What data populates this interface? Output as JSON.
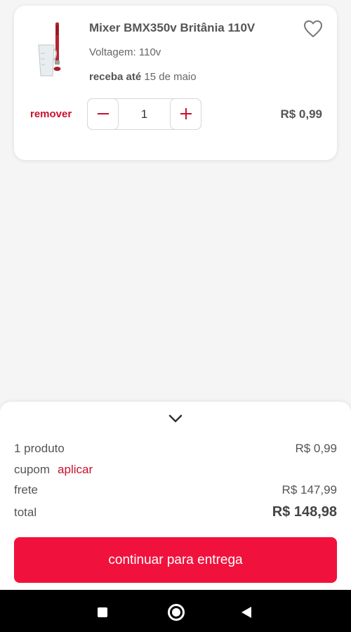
{
  "product": {
    "name": "Mixer BMX350v Britânia 110V",
    "variant": "Voltagem: 110v",
    "delivery_lead": "receba até",
    "delivery_date": "15 de maio",
    "remove_label": "remover",
    "quantity": "1",
    "price": "R$ 0,99",
    "image_icon": "hand-mixer-icon"
  },
  "summary": {
    "products_label": "1 produto",
    "products_value": "R$ 0,99",
    "coupon_label": "cupom",
    "coupon_action": "aplicar",
    "shipping_label": "frete",
    "shipping_value": "R$ 147,99",
    "total_label": "total",
    "total_value": "R$ 148,98",
    "cta_label": "continuar para entrega"
  },
  "colors": {
    "accent": "#c8102e",
    "cta": "#f0123c",
    "background": "#f5f5f5"
  },
  "icons": {
    "favorite": "heart-outline-icon",
    "collapse": "chevron-down-icon",
    "decrease": "minus-icon",
    "increase": "plus-icon",
    "nav_recent": "recent-apps-icon",
    "nav_home": "home-icon",
    "nav_back": "back-icon"
  }
}
